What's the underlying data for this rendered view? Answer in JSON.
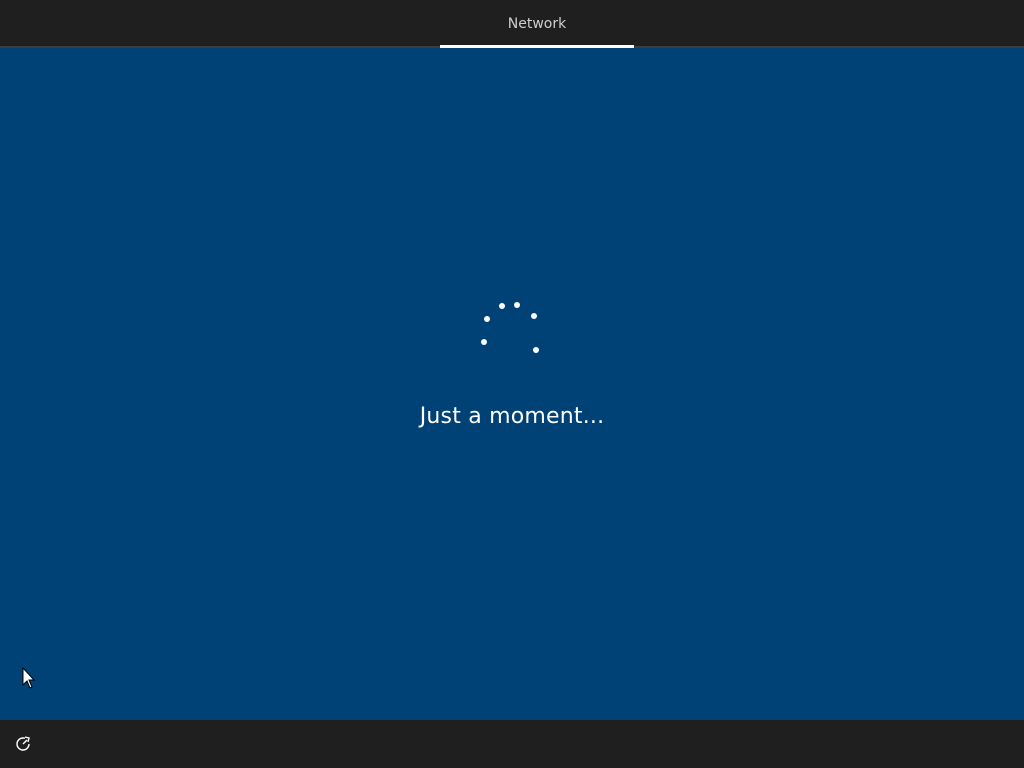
{
  "header": {
    "tabs": [
      {
        "label": "Network",
        "active": true
      }
    ]
  },
  "main": {
    "status_text": "Just a moment..."
  },
  "footer": {
    "ease_of_access_icon": "ease-of-access-icon"
  },
  "colors": {
    "background": "#004275",
    "bar": "#1f1f1f",
    "text": "#ffffff",
    "tab_text": "#cfcfcf"
  }
}
